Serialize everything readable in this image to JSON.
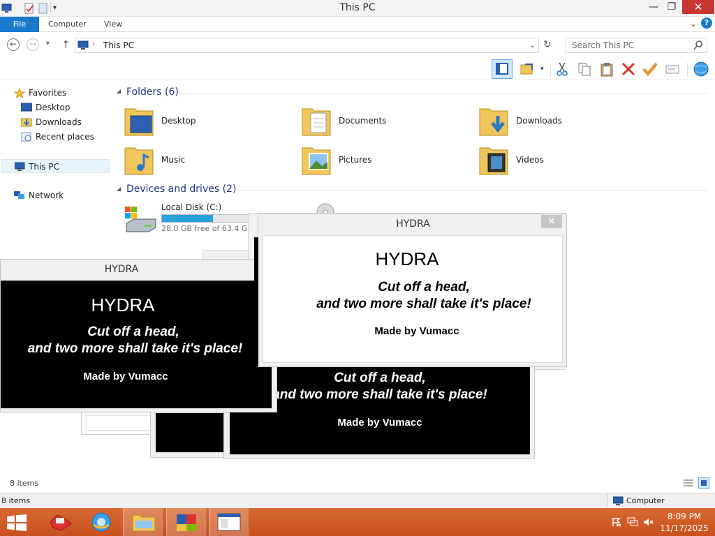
{
  "window": {
    "title": "This PC",
    "minimize": "—",
    "maximize": "❐",
    "close": "✕"
  },
  "ribbon": {
    "file": "File",
    "tabs": [
      "Computer",
      "View"
    ]
  },
  "address": {
    "path": "This PC",
    "search_placeholder": "Search This PC"
  },
  "nav": {
    "favorites": "Favorites",
    "desktop": "Desktop",
    "downloads": "Downloads",
    "recent": "Recent places",
    "this_pc": "This PC",
    "network": "Network"
  },
  "content": {
    "folders_header": "Folders (6)",
    "folders": [
      "Desktop",
      "Documents",
      "Downloads",
      "Music",
      "Pictures",
      "Videos"
    ],
    "drives_header": "Devices and drives (2)",
    "drive_name": "Local Disk (C:)",
    "drive_space": "28.0 GB free of 63.4 GB",
    "drive_used_fraction": 0.56
  },
  "status": {
    "items": "8 items",
    "items2": "8 items",
    "computer": "Computer"
  },
  "hydra": {
    "window_title": "HYDRA",
    "heading": "HYDRA",
    "line1": "Cut off a head,",
    "line2": "and two more shall take it's place!",
    "made_by": "Made by Vumacc",
    "close": "✕"
  },
  "taskbar": {
    "time": "8:09 PM",
    "date": "11/17/2025"
  },
  "colors": {
    "accent_blue": "#1979ca",
    "close_red": "#c7372f",
    "taskbar_orange": "#d35a24",
    "drive_bar": "#26a0da"
  }
}
